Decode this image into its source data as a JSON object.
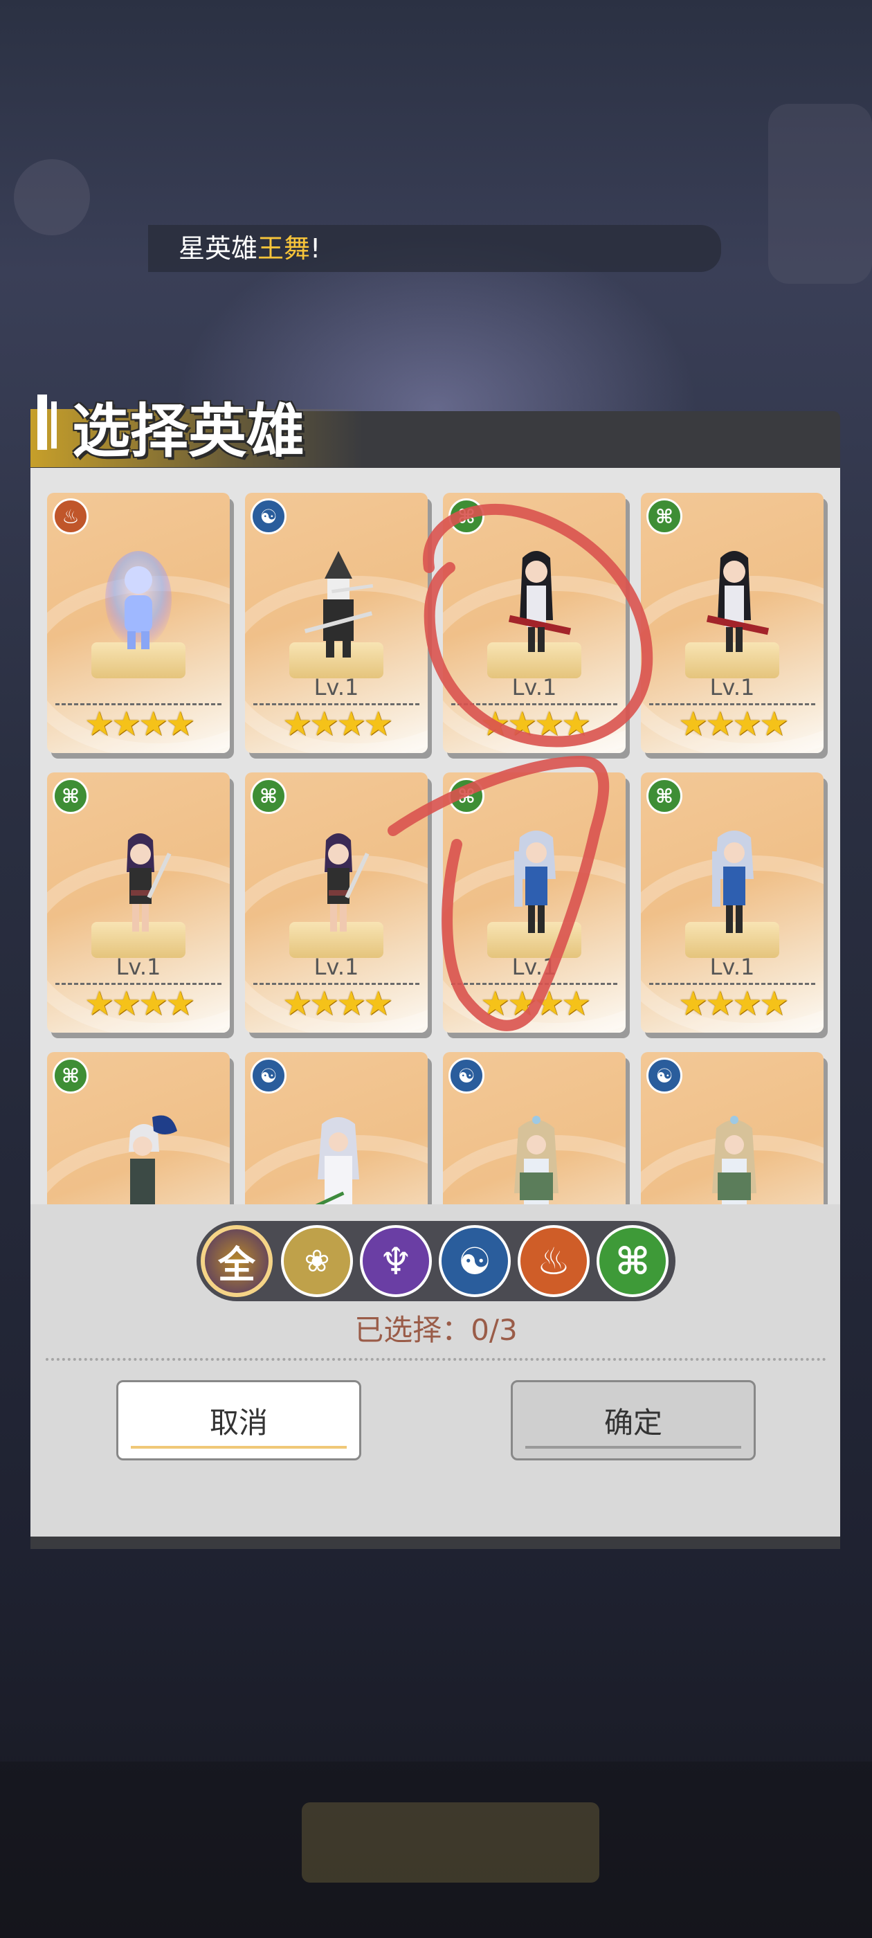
{
  "notice": {
    "text_prefix": "星英雄",
    "text_highlight": "王舞",
    "text_suffix": "!"
  },
  "dialog": {
    "title": "选择英雄",
    "selected_label": "已选择：0/3",
    "cancel_label": "取消",
    "confirm_label": "确定"
  },
  "filters": {
    "all_label": "全",
    "items": [
      "all",
      "lotus",
      "flame",
      "yin-yang",
      "meditation",
      "dna"
    ]
  },
  "cards": [
    {
      "element": "meditation",
      "level": "",
      "stars": "★★★★"
    },
    {
      "element": "yin-yang",
      "level": "Lv.1",
      "stars": "★★★★"
    },
    {
      "element": "dna",
      "level": "Lv.1",
      "stars": "★★★★"
    },
    {
      "element": "dna",
      "level": "Lv.1",
      "stars": "★★★★"
    },
    {
      "element": "dna",
      "level": "Lv.1",
      "stars": "★★★★"
    },
    {
      "element": "dna",
      "level": "Lv.1",
      "stars": "★★★★"
    },
    {
      "element": "dna",
      "level": "Lv.1",
      "stars": "★★★★"
    },
    {
      "element": "dna",
      "level": "Lv.1",
      "stars": "★★★★"
    },
    {
      "element": "dna",
      "level": "",
      "stars": ""
    },
    {
      "element": "yin-yang",
      "level": "",
      "stars": ""
    },
    {
      "element": "yin-yang",
      "level": "",
      "stars": ""
    },
    {
      "element": "yin-yang",
      "level": "",
      "stars": ""
    }
  ],
  "colors": {
    "highlight": "#f7c43a",
    "annotation": "#d9534f",
    "star": "#f5c219"
  }
}
